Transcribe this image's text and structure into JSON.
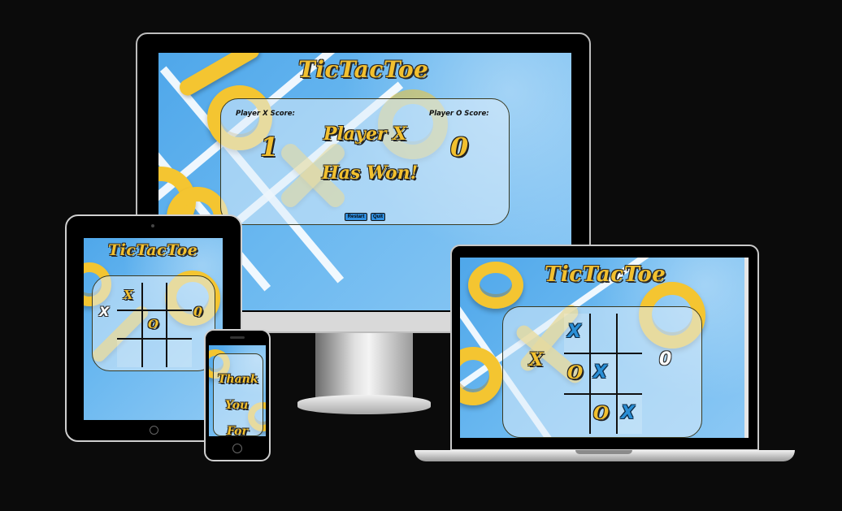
{
  "colors": {
    "accent": "#f2c02f",
    "sky": "#5aaeec",
    "frame": "#000000"
  },
  "desktop": {
    "title": "TicTacToe",
    "player_x_label": "Player X Score:",
    "player_o_label": "Player O Score:",
    "player_x_score": "1",
    "player_o_score": "0",
    "winner_line1": "Player X",
    "winner_line2": "Has Won!",
    "restart_label": "Restart",
    "quit_label": "Quit"
  },
  "tablet": {
    "title": "TicTacToe",
    "left_marker": "X",
    "right_marker": "0",
    "board": [
      "X",
      "",
      "",
      "",
      "O",
      "",
      "",
      "",
      ""
    ]
  },
  "laptop": {
    "title": "TicTacToe",
    "left_marker": "X",
    "right_marker": "0",
    "board": [
      "X",
      "",
      "",
      "O",
      "X",
      "",
      "",
      "O",
      "X"
    ]
  },
  "phone": {
    "line1": "Thank",
    "line2": "You",
    "line3": "For"
  }
}
